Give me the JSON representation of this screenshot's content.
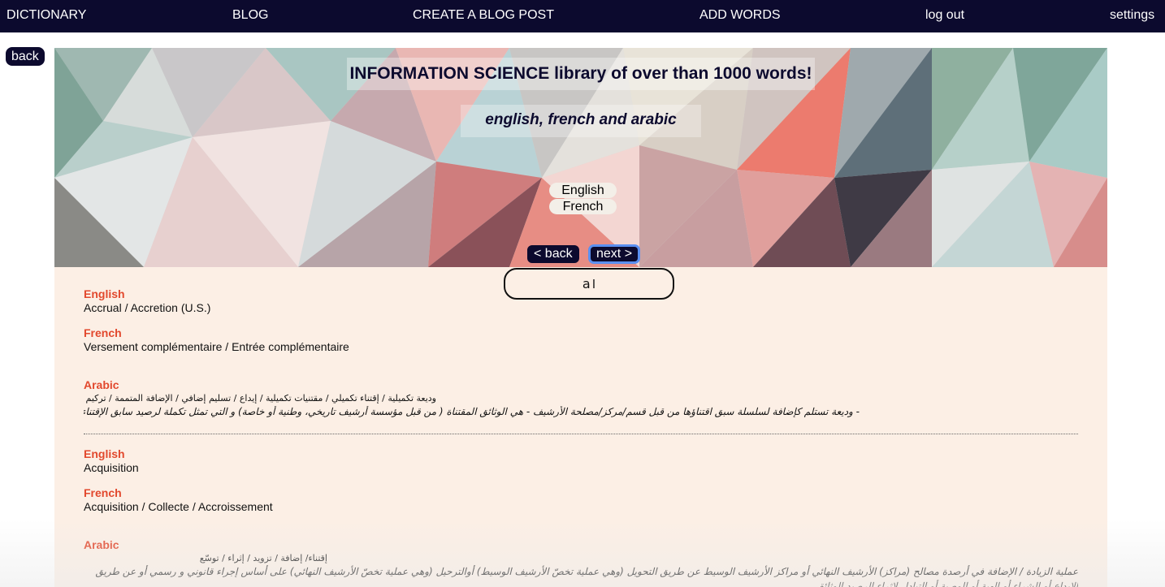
{
  "nav": {
    "items": [
      "DICTIONARY",
      "BLOG",
      "CREATE A BLOG POST",
      "ADD WORDS",
      "log out",
      "settings"
    ]
  },
  "back_label": "back",
  "hero": {
    "title": "INFORMATION SCIENCE library of over than 1000 words!",
    "subtitle": "english, french and arabic",
    "languages": [
      "English",
      "French"
    ],
    "prev_label": "< back",
    "next_label": "next >"
  },
  "search": {
    "value": "a"
  },
  "entries": [
    {
      "english_label": "English",
      "english": "Accrual / Accretion (U.S.)",
      "french_label": "French",
      "french": "Versement complémentaire / Entrée complémentaire",
      "arabic_label": "Arabic",
      "arabic_terms": "وديعة تكميلية / إقتناء تكميلي / مقتنيات تكميلية / إيداع / تسليم إضافي / الإضافة المتممة / تركيم",
      "arabic_definition": "- وديعة تستلم كإضافة لسلسلة سبق اقتناؤها من قبل قسم/مركز/مصلحة الأرشيف - هي الوثائق المقتناة ( من قبل مؤسسة أرشيف تاريخي، وطنية أو خاصة) و التي تمثل تكملة لرصيد سابق الإقتناء"
    },
    {
      "english_label": "English",
      "english": "Acquisition",
      "french_label": "French",
      "french": "Acquisition / Collecte / Accroissement",
      "arabic_label": "Arabic",
      "arabic_terms": "إقتناء/ إضافة / تزويد / إثراء / توسّع",
      "arabic_definition": "عملية الزيادة / الإضافة في أرصدة مصالح (مراكز) الأرشيف النهائي أو مراكز الأرشيف الوسيط عن طريق التحويل (وهي عملية تخصّ الأرشيف الوسيط) أوالترحيل (وهي عملية تخصّ الأرشيف النهائي) على أساس إجراء قانوني و رسمي أو عن طريق الإيداع أو الشراء أو الهبة أو الوصية أو التبادل لإثراء الرصيد الوثائقي"
    }
  ],
  "colors": {
    "nav_bg": "#0c0a2e",
    "label_accent": "#e2482d",
    "content_bg": "#fcefe5"
  }
}
